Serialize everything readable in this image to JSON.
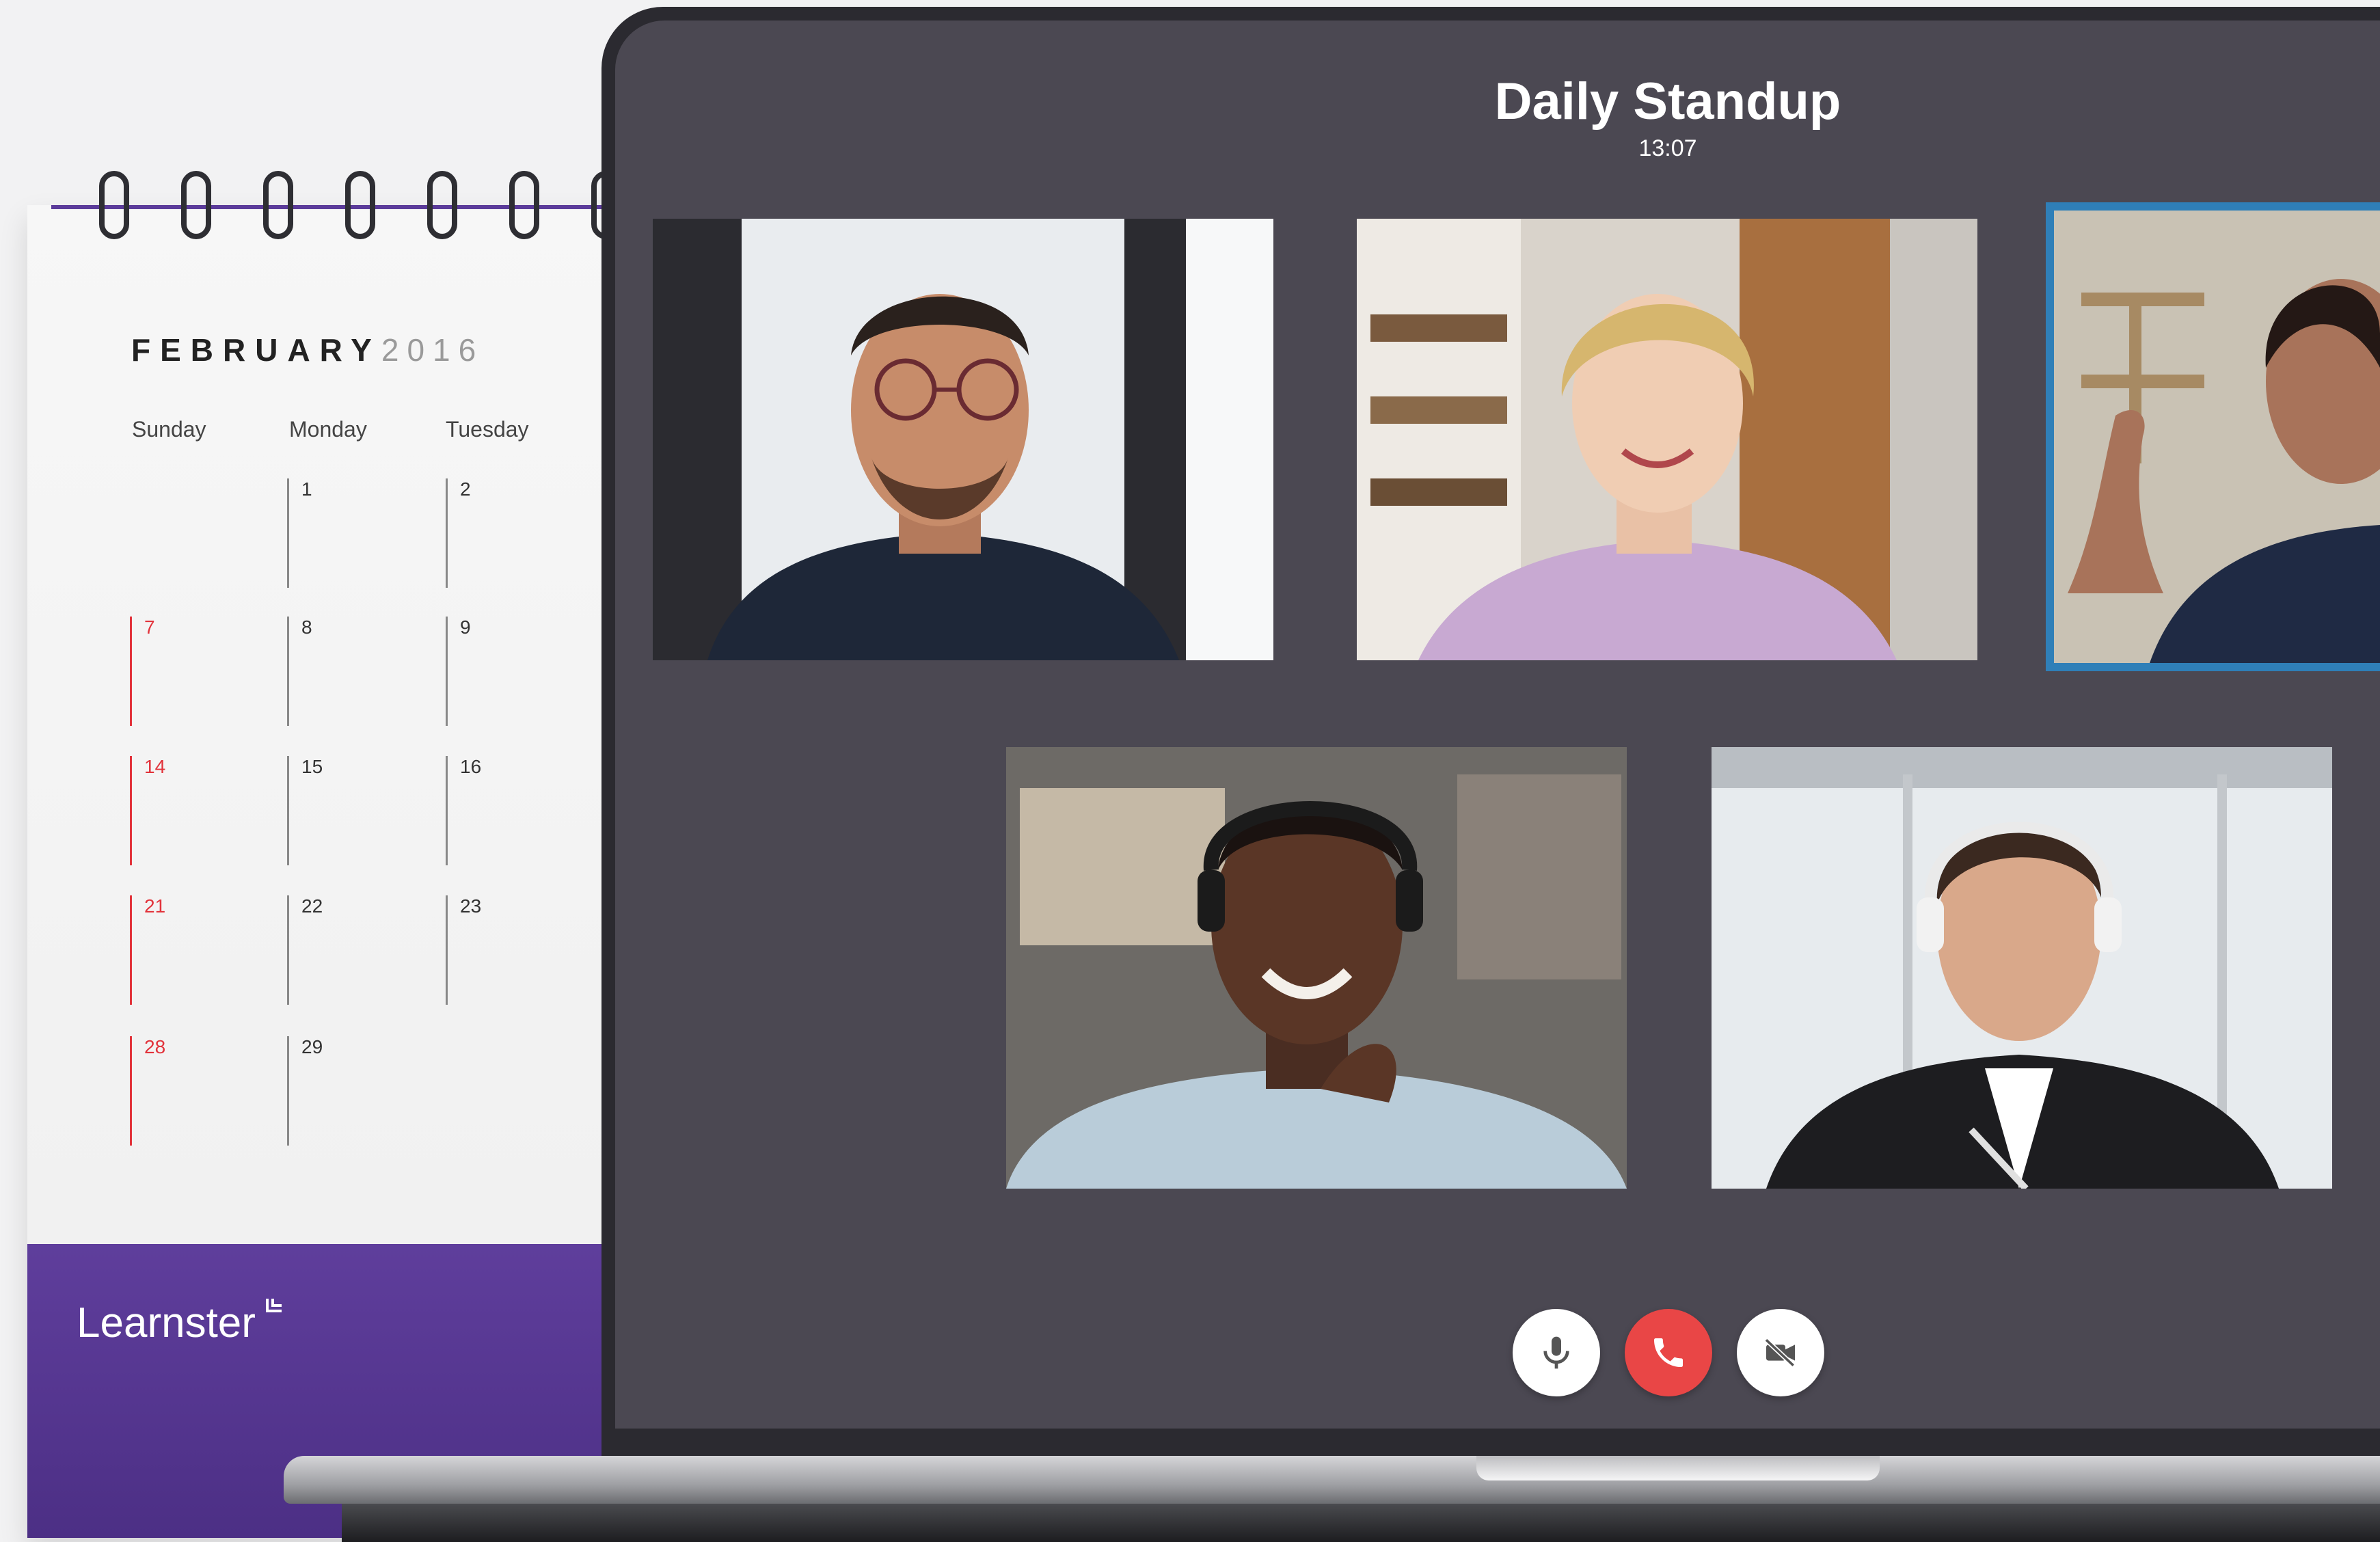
{
  "calendar": {
    "month": "FEBRUARY",
    "year": "2016",
    "weekdays": [
      "Sunday",
      "Monday",
      "Tuesday"
    ],
    "days": {
      "sunday": [
        "7",
        "14",
        "21",
        "28"
      ],
      "monday": [
        "1",
        "8",
        "15",
        "22",
        "29"
      ],
      "tuesday": [
        "2",
        "9",
        "16",
        "23"
      ]
    },
    "brand": "Learnster"
  },
  "call": {
    "title": "Daily Standup",
    "time": "13:07",
    "participants": [
      {
        "id": "p1",
        "active": false,
        "icon": "participant-video"
      },
      {
        "id": "p2",
        "active": false,
        "icon": "participant-video"
      },
      {
        "id": "p3",
        "active": true,
        "icon": "participant-video"
      },
      {
        "id": "p4",
        "active": false,
        "icon": "participant-video"
      },
      {
        "id": "p5",
        "active": false,
        "icon": "participant-video"
      }
    ],
    "controls": [
      {
        "name": "microphone-button",
        "icon": "microphone-icon"
      },
      {
        "name": "end-call-button",
        "icon": "phone-icon"
      },
      {
        "name": "camera-off-button",
        "icon": "video-off-icon"
      }
    ]
  },
  "colors": {
    "screen_bg": "#4b4852",
    "active_speaker": "#2f7fb8",
    "end_call": "#e94646",
    "brand_purple": "#5f3e9c",
    "sunday_red": "#e2333b"
  }
}
